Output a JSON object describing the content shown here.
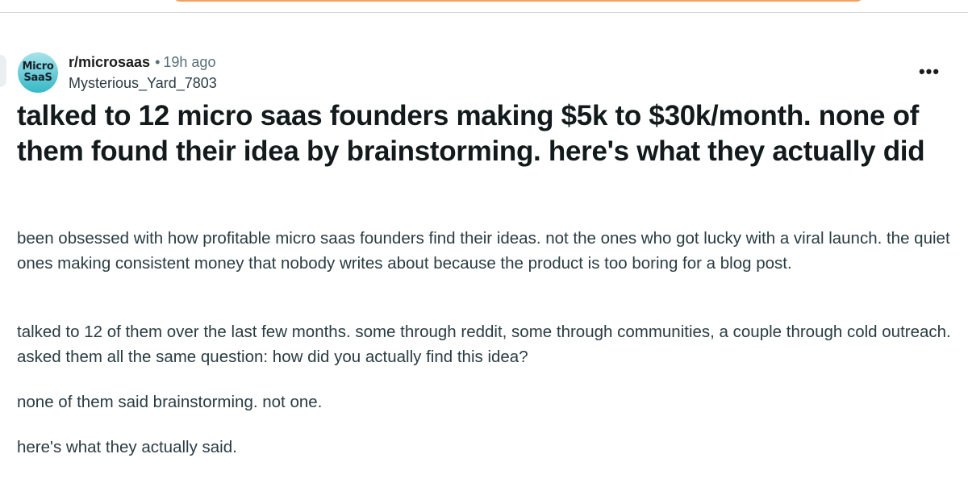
{
  "post": {
    "subreddit_avatar_text": [
      "Micro",
      "SaaS"
    ],
    "subreddit": "r/microsaas",
    "separator": "•",
    "time": "19h ago",
    "author": "Mysterious_Yard_7803",
    "more_label": "•••",
    "title": "talked to 12 micro saas founders making $5k to $30k/month. none of them found their idea by brainstorming. here's what they actually did",
    "paragraphs": [
      "been obsessed with how profitable micro saas founders find their ideas. not the ones who got lucky with a viral launch. the quiet ones making consistent money that nobody writes about because the product is too boring for a blog post.",
      "talked to 12 of them over the last few months. some through reddit, some through communities, a couple through cold outreach. asked them all the same question: how did you actually find this idea?",
      "none of them said brainstorming. not one.",
      "here's what they actually said."
    ]
  },
  "icons": {
    "more": "ellipsis-icon"
  },
  "colors": {
    "search_border": "#f5a05b",
    "avatar_gradient_top": "#a9e3ea",
    "avatar_gradient_bottom": "#35b8c6",
    "title_text": "#131a1c",
    "body_text": "#2a3c42",
    "meta_text": "#576f76"
  }
}
